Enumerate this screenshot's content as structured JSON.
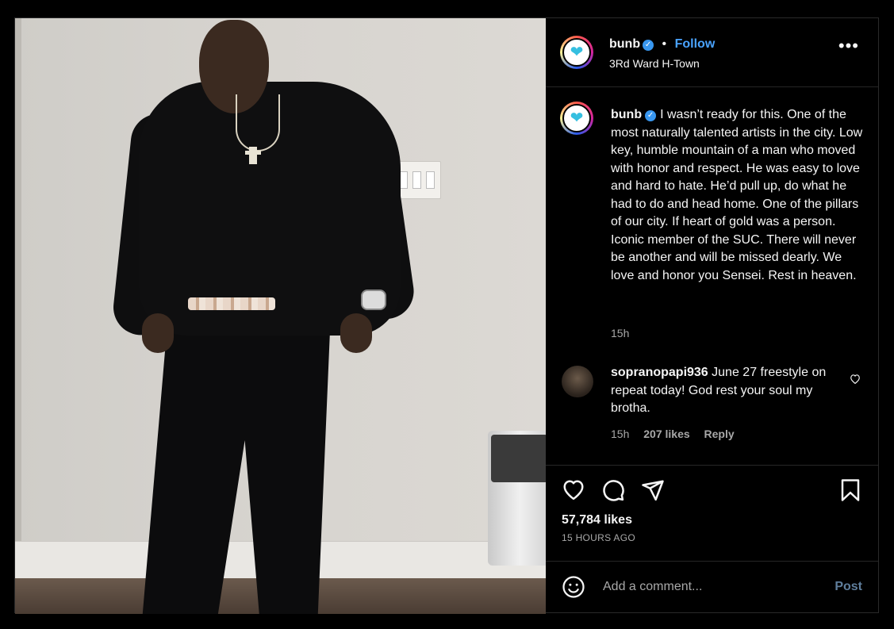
{
  "post": {
    "username": "bunb",
    "location": "3Rd Ward H-Town",
    "follow_label": "Follow",
    "dot": "•",
    "more_label": "•••",
    "caption": "I wasn’t ready for this. One of the most naturally talented artists in the city. Low key, humble mountain of a man who moved with honor and respect. He was easy to love and hard to hate. He’d pull up, do what he had to do and head home. One of the pillars of our city. If heart of gold was a person. Iconic member of the SUC. There will never be another and will be missed dearly. We love and honor you Sensei. Rest in heaven.",
    "caption_time": "15h",
    "likes": "57,784 likes",
    "posted": "15 HOURS AGO"
  },
  "comment": {
    "username": "sopranopapi936",
    "text": "June 27 freestyle on repeat today! God rest your soul my brotha.",
    "time": "15h",
    "likes": "207 likes",
    "reply": "Reply"
  },
  "composer": {
    "placeholder": "Add a comment...",
    "post_label": "Post"
  },
  "colors": {
    "follow": "#4aa3ff",
    "verified": "#3897f0",
    "post_button": "#5f7e9c"
  },
  "icons": [
    "heart-icon",
    "comment-icon",
    "share-icon",
    "bookmark-icon",
    "emoji-icon",
    "verified-icon",
    "more-icon"
  ]
}
